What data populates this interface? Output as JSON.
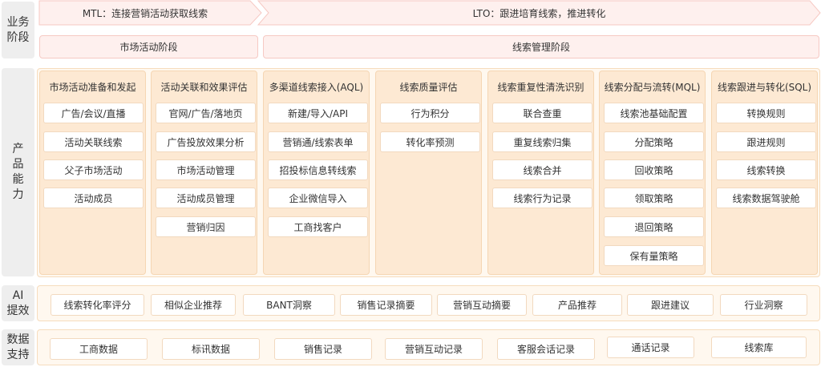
{
  "row_labels": {
    "business_stage": [
      "业务",
      "阶段"
    ],
    "product_capability": [
      "产",
      "品",
      "能",
      "力"
    ],
    "ai_power": [
      "AI",
      "提效"
    ],
    "data_support": [
      "数据",
      "支持"
    ]
  },
  "chevrons": {
    "mtl": "MTL：连接营销活动获取线索",
    "lto": "LTO：跟进培育线索，推进转化"
  },
  "stages": {
    "market": "市场活动阶段",
    "leads": "线索管理阶段"
  },
  "columns": [
    {
      "title": "市场活动准备和发起",
      "items": [
        "广告/会议/直播",
        "活动关联线索",
        "父子市场活动",
        "活动成员"
      ]
    },
    {
      "title": "活动关联和效果评估",
      "items": [
        "官网/广告/落地页",
        "广告投放效果分析",
        "市场活动管理",
        "活动成员管理",
        "营销归因"
      ]
    },
    {
      "title": "多渠道线索接入(AQL)",
      "items": [
        "新建/导入/API",
        "营销通/线索表单",
        "招投标信息转线索",
        "企业微信导入",
        "工商找客户"
      ]
    },
    {
      "title": "线索质量评估",
      "items": [
        "行为积分",
        "转化率预测"
      ]
    },
    {
      "title": "线索重复性清洗识别",
      "items": [
        "联合查重",
        "重复线索归集",
        "线索合并",
        "线索行为记录"
      ]
    },
    {
      "title": "线索分配与流转(MQL)",
      "items": [
        "线索池基础配置",
        "分配策略",
        "回收策略",
        "领取策略",
        "退回策略",
        "保有量策略"
      ]
    },
    {
      "title": "线索跟进与转化(SQL)",
      "items": [
        "转换规则",
        "跟进规则",
        "线索转换",
        "线索数据驾驶舱"
      ]
    }
  ],
  "ai_items": [
    "线索转化率评分",
    "相似企业推荐",
    "BANT洞察",
    "销售记录摘要",
    "营销互动摘要",
    "产品推荐",
    "跟进建议",
    "行业洞察"
  ],
  "data_items": [
    "工商数据",
    "标讯数据",
    "销售记录",
    "营销互动记录",
    "客服会话记录",
    "通话记录",
    "线索库"
  ],
  "colors": {
    "stage_fill": "#fef0ee",
    "stage_border": "#f6c9c3",
    "column_fill": "#fde9d3",
    "band_fill": "#fff8ef",
    "label_fill": "#eeeeee"
  }
}
